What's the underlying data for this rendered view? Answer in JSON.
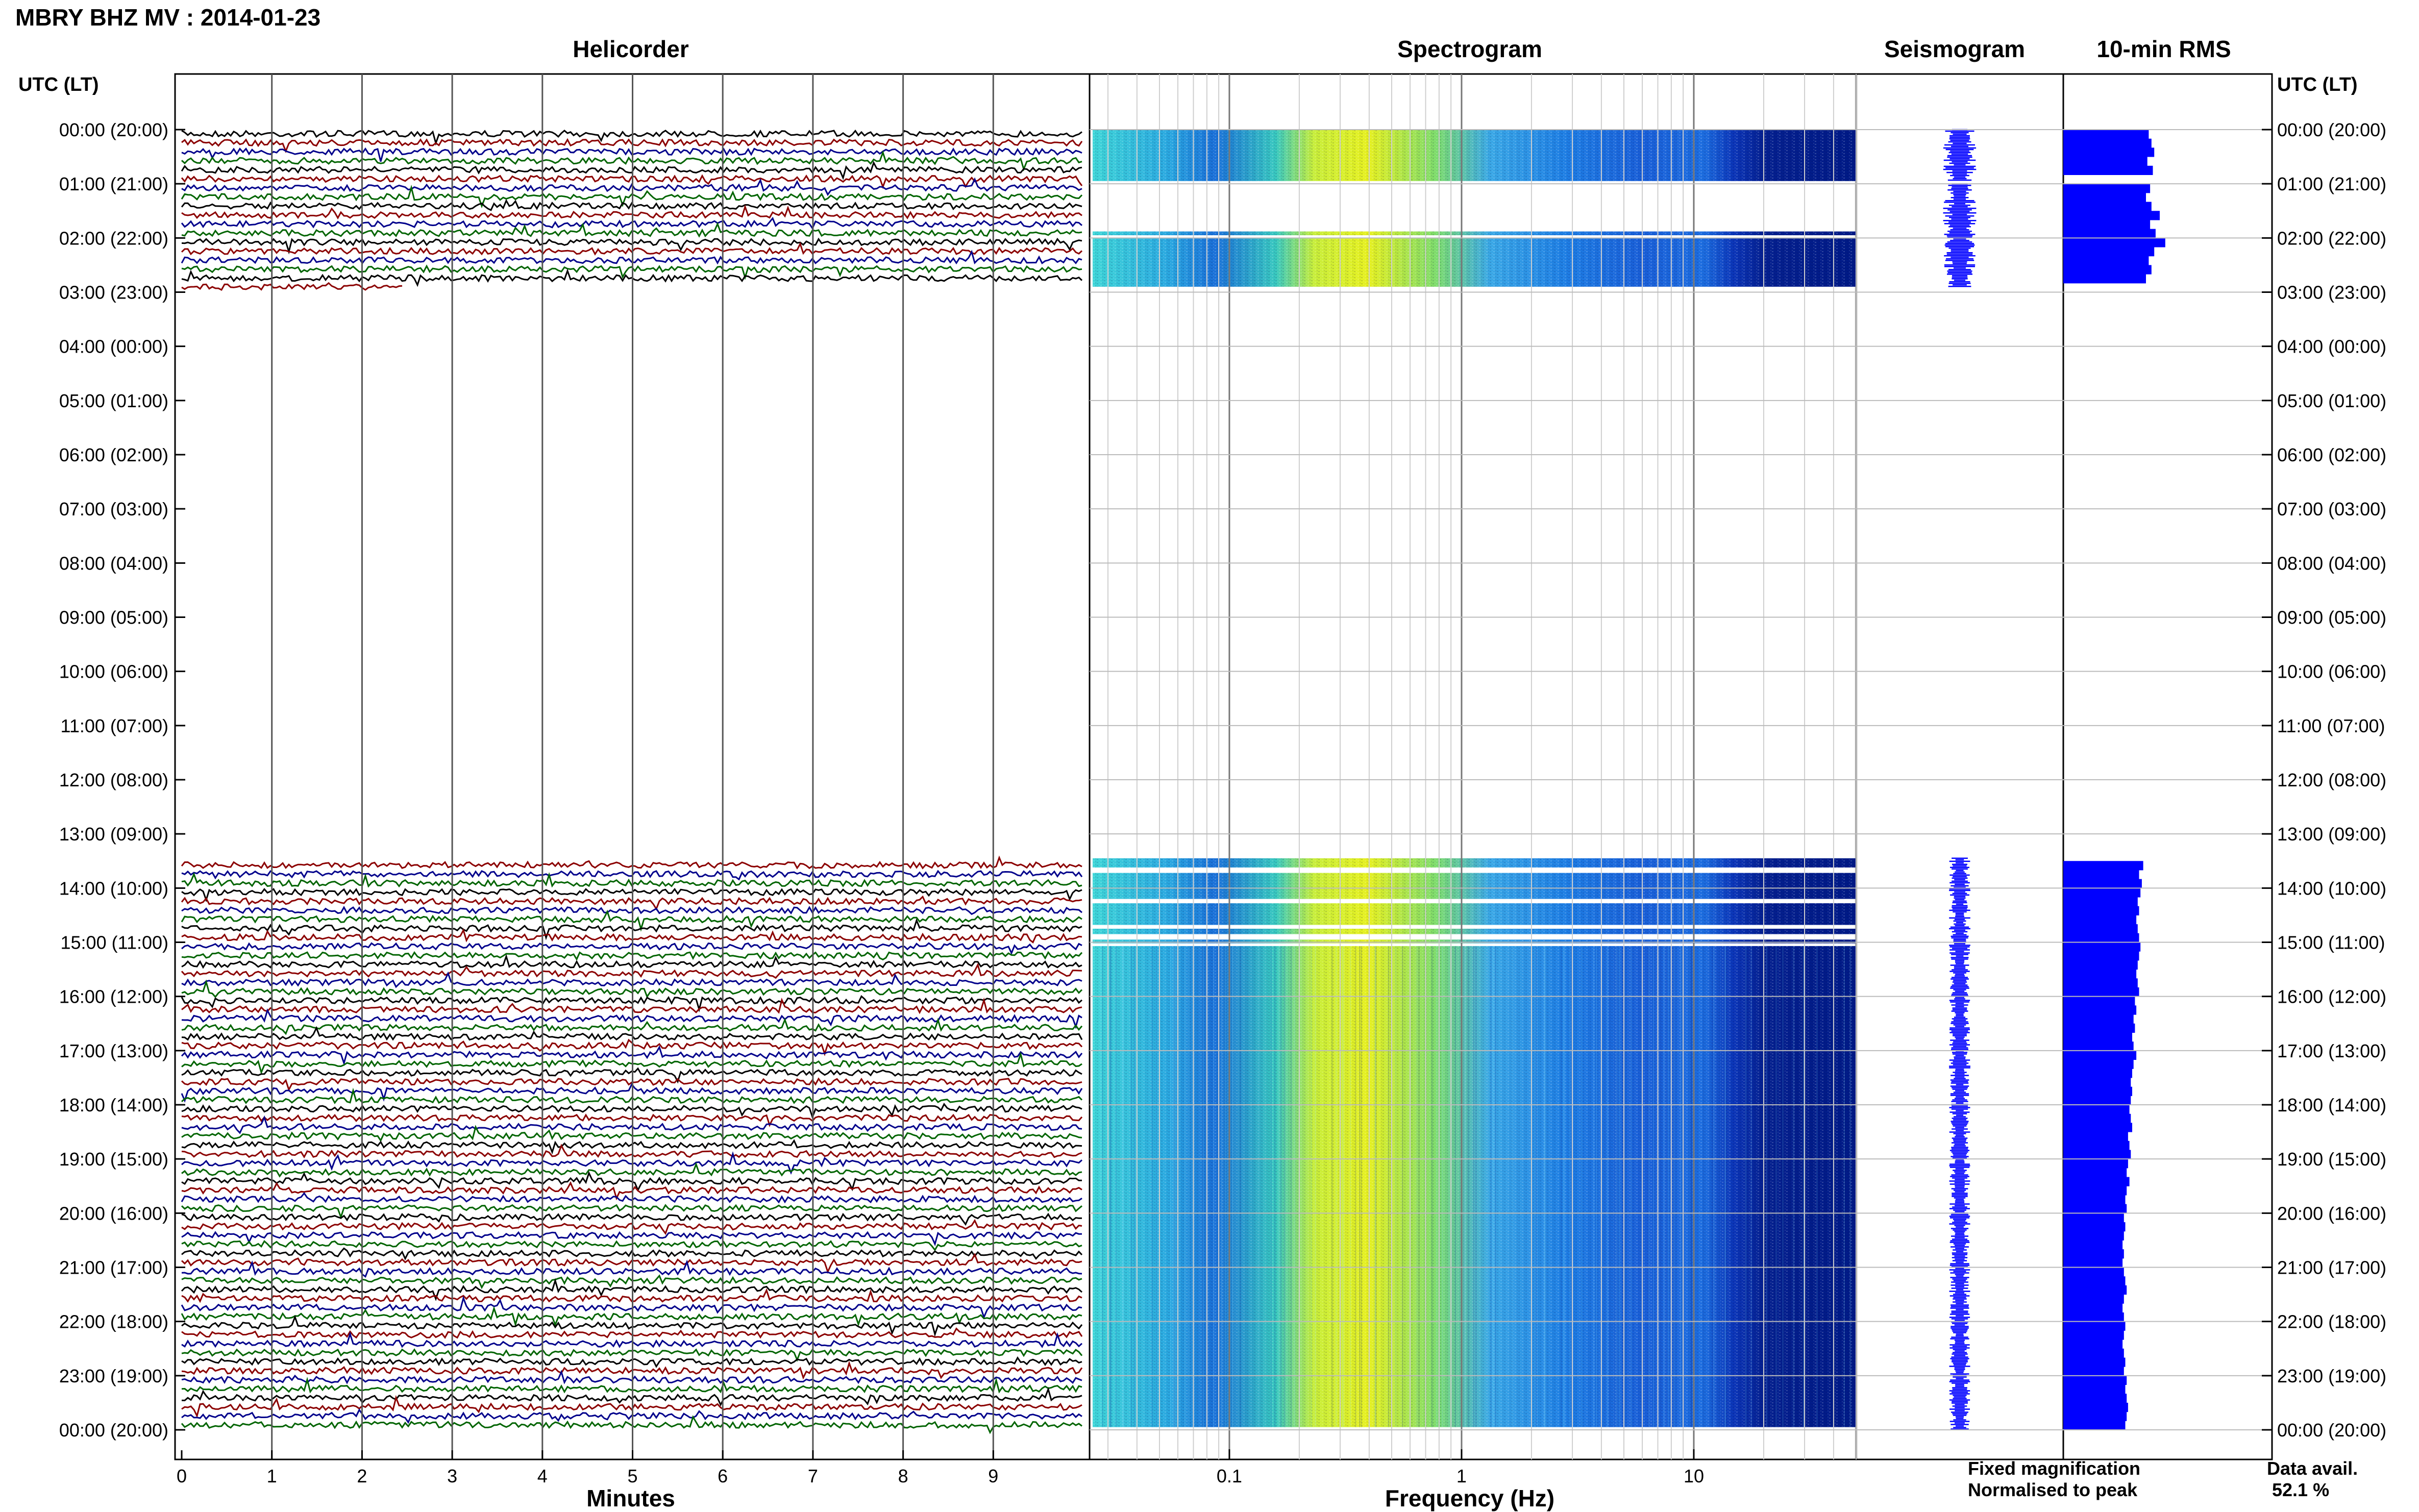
{
  "chart_data": {
    "type": "helicorder",
    "title": "MBRY BHZ MV : 2014-01-23",
    "panels": {
      "helicorder": {
        "title": "Helicorder",
        "xlabel": "Minutes",
        "xticks": [
          "0",
          "1",
          "2",
          "3",
          "4",
          "5",
          "6",
          "7",
          "8",
          "9"
        ],
        "xlim": [
          0,
          10
        ]
      },
      "spectrogram": {
        "title": "Spectrogram",
        "xlabel": "Frequency (Hz)",
        "xticks": [
          "0.1",
          "1",
          "10"
        ],
        "scale": "log",
        "xlim": [
          0.025,
          50
        ]
      },
      "seismogram": {
        "title": "Seismogram"
      },
      "rms": {
        "title": "10-min RMS"
      }
    },
    "ylabel_left": "UTC (LT)",
    "ylabel_right": "UTC (LT)",
    "yticks": [
      "00:00 (20:00)",
      "01:00 (21:00)",
      "02:00 (22:00)",
      "03:00 (23:00)",
      "04:00 (00:00)",
      "05:00 (01:00)",
      "06:00 (02:00)",
      "07:00 (03:00)",
      "08:00 (04:00)",
      "09:00 (05:00)",
      "10:00 (06:00)",
      "11:00 (07:00)",
      "12:00 (08:00)",
      "13:00 (09:00)",
      "14:00 (10:00)",
      "15:00 (11:00)",
      "16:00 (12:00)",
      "17:00 (13:00)",
      "18:00 (14:00)",
      "19:00 (15:00)",
      "20:00 (16:00)",
      "21:00 (17:00)",
      "22:00 (18:00)",
      "23:00 (19:00)",
      "00:00 (20:00)"
    ],
    "data_segments_utc_hours": [
      [
        0.0,
        0.95
      ],
      [
        1.0,
        2.9
      ],
      [
        13.45,
        15.0
      ],
      [
        15.0,
        24.0
      ]
    ],
    "trace_colors": [
      "#000000",
      "#8b0000",
      "#00008b",
      "#006400"
    ],
    "legend": [
      {
        "label": "Fixed magnification",
        "color": "#0000ff"
      },
      {
        "label": "Normalised to peak",
        "color": "#ff0000"
      }
    ],
    "data_availability": {
      "label": "Data avail.",
      "value": "52.1 %"
    },
    "rms_bars": [
      {
        "t": 0.0,
        "v": 0.62
      },
      {
        "t": 0.167,
        "v": 0.64
      },
      {
        "t": 0.333,
        "v": 0.66
      },
      {
        "t": 0.5,
        "v": 0.61
      },
      {
        "t": 0.667,
        "v": 0.65
      },
      {
        "t": 1.0,
        "v": 0.63
      },
      {
        "t": 1.167,
        "v": 0.6
      },
      {
        "t": 1.333,
        "v": 0.64
      },
      {
        "t": 1.5,
        "v": 0.7
      },
      {
        "t": 1.667,
        "v": 0.63
      },
      {
        "t": 1.833,
        "v": 0.67
      },
      {
        "t": 2.0,
        "v": 0.74
      },
      {
        "t": 2.167,
        "v": 0.66
      },
      {
        "t": 2.333,
        "v": 0.62
      },
      {
        "t": 2.5,
        "v": 0.64
      },
      {
        "t": 2.667,
        "v": 0.6
      },
      {
        "t": 13.5,
        "v": 0.58
      },
      {
        "t": 13.667,
        "v": 0.55
      },
      {
        "t": 13.833,
        "v": 0.57
      },
      {
        "t": 14.0,
        "v": 0.56
      },
      {
        "t": 14.167,
        "v": 0.54
      },
      {
        "t": 14.333,
        "v": 0.55
      },
      {
        "t": 14.5,
        "v": 0.53
      },
      {
        "t": 14.667,
        "v": 0.54
      },
      {
        "t": 14.833,
        "v": 0.55
      },
      {
        "t": 15.0,
        "v": 0.56
      },
      {
        "t": 15.167,
        "v": 0.55
      },
      {
        "t": 15.333,
        "v": 0.54
      },
      {
        "t": 15.5,
        "v": 0.53
      },
      {
        "t": 15.667,
        "v": 0.54
      },
      {
        "t": 15.833,
        "v": 0.55
      },
      {
        "t": 16.0,
        "v": 0.52
      },
      {
        "t": 16.167,
        "v": 0.53
      },
      {
        "t": 16.333,
        "v": 0.51
      },
      {
        "t": 16.5,
        "v": 0.52
      },
      {
        "t": 16.667,
        "v": 0.5
      },
      {
        "t": 16.833,
        "v": 0.51
      },
      {
        "t": 17.0,
        "v": 0.53
      },
      {
        "t": 17.167,
        "v": 0.51
      },
      {
        "t": 17.333,
        "v": 0.5
      },
      {
        "t": 17.5,
        "v": 0.49
      },
      {
        "t": 17.667,
        "v": 0.5
      },
      {
        "t": 17.833,
        "v": 0.49
      },
      {
        "t": 18.0,
        "v": 0.48
      },
      {
        "t": 18.167,
        "v": 0.49
      },
      {
        "t": 18.333,
        "v": 0.5
      },
      {
        "t": 18.5,
        "v": 0.47
      },
      {
        "t": 18.667,
        "v": 0.48
      },
      {
        "t": 18.833,
        "v": 0.49
      },
      {
        "t": 19.0,
        "v": 0.47
      },
      {
        "t": 19.167,
        "v": 0.46
      },
      {
        "t": 19.333,
        "v": 0.48
      },
      {
        "t": 19.5,
        "v": 0.46
      },
      {
        "t": 19.667,
        "v": 0.45
      },
      {
        "t": 19.833,
        "v": 0.46
      },
      {
        "t": 20.0,
        "v": 0.44
      },
      {
        "t": 20.167,
        "v": 0.45
      },
      {
        "t": 20.333,
        "v": 0.44
      },
      {
        "t": 20.5,
        "v": 0.43
      },
      {
        "t": 20.667,
        "v": 0.44
      },
      {
        "t": 20.833,
        "v": 0.43
      },
      {
        "t": 21.0,
        "v": 0.44
      },
      {
        "t": 21.167,
        "v": 0.45
      },
      {
        "t": 21.333,
        "v": 0.46
      },
      {
        "t": 21.5,
        "v": 0.44
      },
      {
        "t": 21.667,
        "v": 0.43
      },
      {
        "t": 21.833,
        "v": 0.44
      },
      {
        "t": 22.0,
        "v": 0.45
      },
      {
        "t": 22.167,
        "v": 0.44
      },
      {
        "t": 22.333,
        "v": 0.43
      },
      {
        "t": 22.5,
        "v": 0.44
      },
      {
        "t": 22.667,
        "v": 0.45
      },
      {
        "t": 22.833,
        "v": 0.44
      },
      {
        "t": 23.0,
        "v": 0.46
      },
      {
        "t": 23.167,
        "v": 0.45
      },
      {
        "t": 23.333,
        "v": 0.46
      },
      {
        "t": 23.5,
        "v": 0.47
      },
      {
        "t": 23.667,
        "v": 0.46
      },
      {
        "t": 23.833,
        "v": 0.45
      }
    ]
  }
}
